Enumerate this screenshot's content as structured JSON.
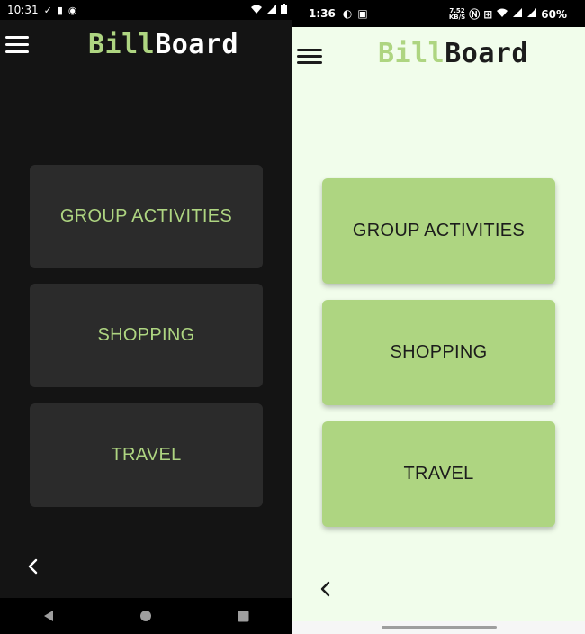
{
  "left": {
    "status": {
      "time": "10:31",
      "icons": [
        "check-icon",
        "sd-card-icon",
        "vpn-icon"
      ],
      "right_icons": [
        "wifi-icon",
        "signal-icon",
        "battery-icon"
      ]
    },
    "brand": {
      "part1": "Bill",
      "part2": "Board"
    },
    "tiles": [
      "GROUP ACTIVITIES",
      "SHOPPING",
      "TRAVEL"
    ],
    "colors": {
      "background": "#141414",
      "tile": "#2b2b2b",
      "accent": "#aed581",
      "brand_part2": "#ffffff"
    }
  },
  "right": {
    "status": {
      "time": "1:36",
      "icons": [
        "pocket-icon",
        "image-icon"
      ],
      "right_icons": [
        "speed-indicator",
        "nfc-icon",
        "volte-icon",
        "wifi-icon",
        "signal-icon",
        "signal-icon",
        "battery-icon"
      ],
      "speed": "7.52",
      "speed_unit": "KB/S",
      "battery_percent": "60%"
    },
    "brand": {
      "part1": "Bill",
      "part2": "Board"
    },
    "tiles": [
      "GROUP ACTIVITIES",
      "SHOPPING",
      "TRAVEL"
    ],
    "colors": {
      "background": "#f1fdeb",
      "tile": "#aed581",
      "text": "#1c1c1c",
      "brand_part2": "#1c1c1c"
    }
  }
}
